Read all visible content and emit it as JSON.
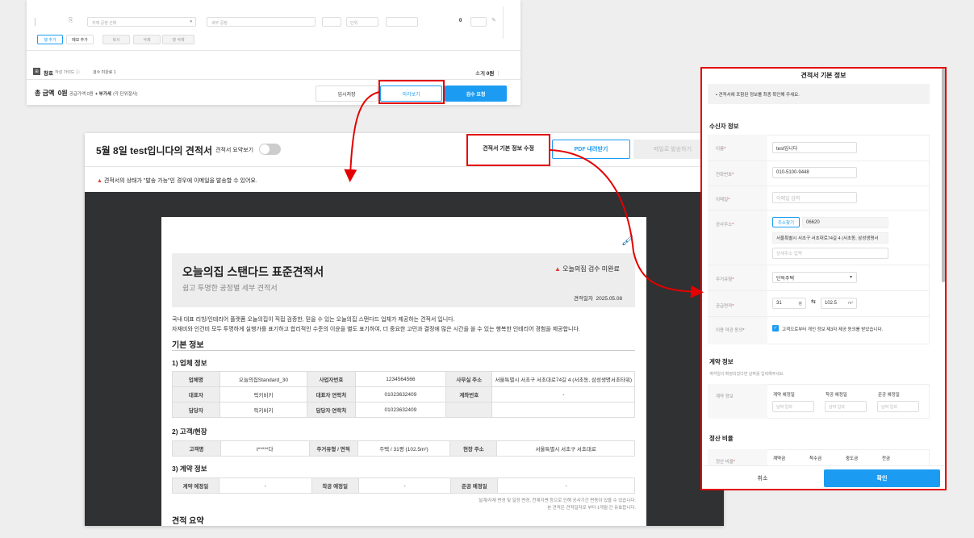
{
  "top": {
    "select_placeholder": "자재 공정 선택",
    "work_placeholder": "세부 공정",
    "unit_placeholder": "단위",
    "qty_value": "0",
    "row_add": "행 추가",
    "memo_add": "메모 추가",
    "copy": "복사",
    "delete": "삭제",
    "row_delete": "행 삭제",
    "section_label": "창호",
    "guide_label": "작성 가이드",
    "check_label": "검수 미완료 1",
    "subtotal_label": "소계",
    "subtotal_value": "0원",
    "total_label": "총 금액",
    "total_value": "0원",
    "supply_label": "공급가액 0원",
    "vat_label": "+ 부가세",
    "vat_note": "(각 단위절사)",
    "temp_save": "임시저장",
    "preview": "미리보기",
    "request_review": "검수 요청"
  },
  "mid": {
    "title": "5월 8일 test입니다의 견적서",
    "summary_toggle_label": "견적서 요약보기",
    "edit_info_button": "견적서 기본 정보 수정",
    "pdf_button": "PDF 내려받기",
    "email_button": "메일로 발송하기",
    "warning_text": "견적서의 상태가 \"발송 가능\"인 경우에 이메일을 발송할 수 있어요."
  },
  "doc": {
    "main_title": "오늘의집 스탠다드 표준견적서",
    "subtitle": "쉽고 투명한 공정별 세부 견적서",
    "check_status": "오늘의집 검수 미완료",
    "date_label": "견적일자",
    "date_value": "2025.05.08",
    "intro_line1": "국내 대표 리빙/인테리어 플랫폼 오늘의집이 직접 검증한, 믿을 수 있는 오늘의집 스탠다드 업체가 제공하는 견적서 입니다.",
    "intro_line2": "자재비와 인건비 모두 투명하게 실행가를 표기하고 합리적인 수준의 이윤을 별도 표기하여, 더 중요한 고민과 결정에 많은 시간을 쓸 수 있는 행복한 인테리어 경험을 제공합니다.",
    "basic_info": "기본 정보",
    "sec1": "1) 업체 정보",
    "company_name_label": "업체명",
    "company_name": "오늘의집Standard_30",
    "biz_no_label": "사업자번호",
    "biz_no": "1234564566",
    "office_label": "사무실 주소",
    "office_addr": "서울특별시 서초구 서초대로74길 4 (서초동, 삼성생명서초타워)",
    "ceo_label": "대표자",
    "ceo": "릭키비키",
    "ceo_phone_label": "대표자 연락처",
    "ceo_phone": "01023632409",
    "account_label": "계좌번호",
    "account": "-",
    "manager_label": "담당자",
    "manager": "릭키비키",
    "manager_phone_label": "담당자 연락처",
    "manager_phone": "01023632409",
    "sec2": "2) 고객/현장",
    "customer_label": "고객명",
    "customer": "t*****다",
    "house_label": "주거유형 / 면적",
    "house": "주택 / 31평 (102.5m²)",
    "site_label": "현장 주소",
    "site": "서울특별시 서초구 서초대로",
    "sec3": "3) 계약 정보",
    "contract_date_label": "계약 예정일",
    "contract_date": "-",
    "start_date_label": "착공 예정일",
    "start_date": "-",
    "end_date_label": "준공 예정일",
    "end_date": "-",
    "note1": "설계/자재 변경 및 일정 변경, 천재지변 등으로 인해 공사기간 변동이 있을 수 있습니다.",
    "note2": "본 견적은 견적일자로 부터 1개월 간 유효합니다.",
    "summary": "견적 요약"
  },
  "right": {
    "title": "견적서 기본 정보",
    "notice": "견적서에 포함된 정보를 최종 확인해 주세요.",
    "recipient_section": "수신자 정보",
    "name_label": "이름",
    "name_value": "test입니다",
    "phone_label": "전화번호",
    "phone_value": "010-5100-9448",
    "email_label": "이메일",
    "email_placeholder": "이메일 입력",
    "address_label": "공사주소",
    "address_search": "주소찾기",
    "zipcode": "06620",
    "address_value": "서울특별시 서초구 서초대로74길 4 (서초동, 삼성생명서",
    "address_detail_placeholder": "상세주소 입력",
    "house_type_label": "주거유형",
    "house_type_value": "단독주택",
    "area_label": "공급면적",
    "area_pyeong": "31",
    "pyeong_unit": "평",
    "area_m2": "102.5",
    "m2_unit": "m²",
    "consent_label": "이용 약관 동의",
    "consent_text": "고객으로부터 개인 정보 제3자 제공 동의를 받았습니다.",
    "contract_section": "계약 정보",
    "contract_desc": "계약일이 확정되었다면 날짜를 입력해주세요.",
    "contract_info_label": "계약 정보",
    "contract_date_label": "계약 예정일",
    "start_date_label": "착공 예정일",
    "end_date_label": "준공 예정일",
    "date_placeholder": "날짜 입력",
    "ratio_section": "정산 비율",
    "ratio_label": "정산 비율",
    "ratio_col1": "계약금",
    "ratio_col2": "착수금",
    "ratio_col3": "중도금",
    "ratio_col4": "잔금",
    "cancel": "취소",
    "confirm": "확인"
  }
}
